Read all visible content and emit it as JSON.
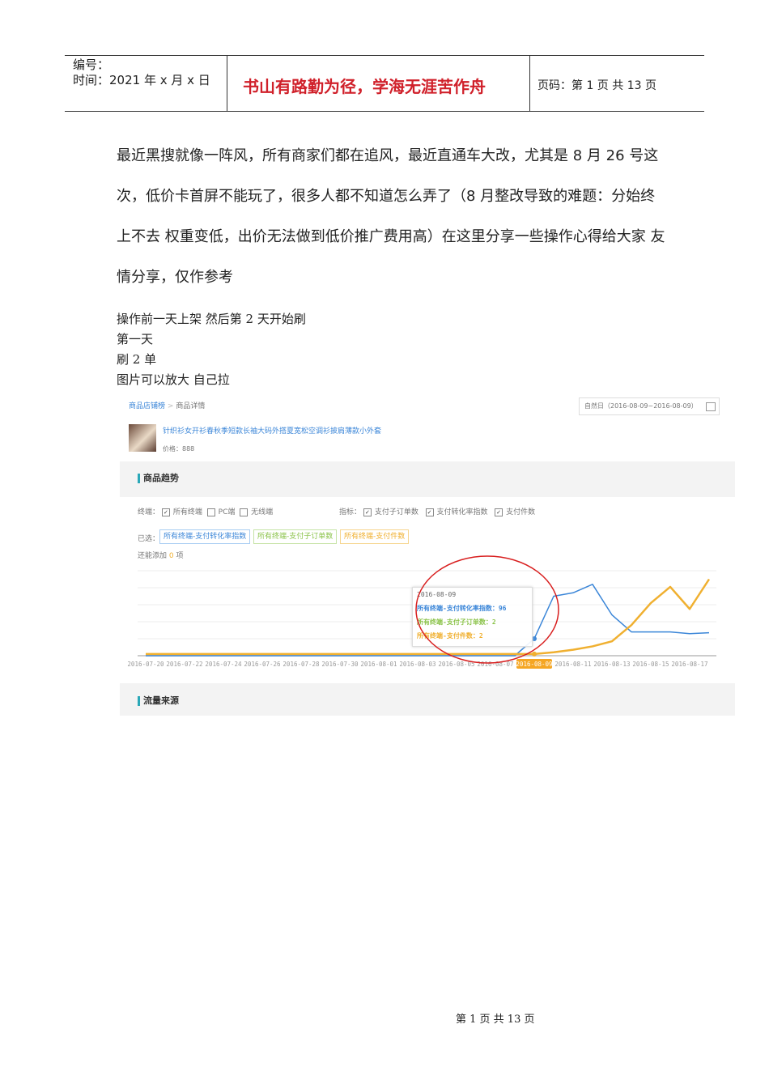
{
  "header": {
    "number_label": "编号：",
    "date_line": "时间：2021 年 x 月 x 日",
    "motto": "书山有路勤为径，学海无涯苦作舟",
    "page_info": "页码：第 1 页  共 13 页"
  },
  "body": {
    "paragraph": "最近黑搜就像一阵风，所有商家们都在追风，最近直通车大改，尤其是 8 月 26 号这次，低价卡首屏不能玩了，很多人都不知道怎么弄了（8 月整改导致的难题：分始终上不去 权重变低，出价无法做到低价推广费用高）在这里分享一些操作心得给大家  友情分享，仅作参考",
    "lines": [
      "操作前一天上架  然后第 2 天开始刷",
      "第一天",
      "刷 2 单",
      "图片可以放大  自己拉"
    ]
  },
  "shot": {
    "breadcrumb": [
      "商品店铺榜",
      "商品详情"
    ],
    "date_range": "自然日（2016-08-09~2016-08-09）",
    "product_title": "针织衫女开衫春秋季短款长袖大码外搭夏宽松空调衫披肩薄款小外套",
    "price": "价格：888",
    "trend_title": "商品趋势",
    "terminal_label": "终端：",
    "terminals": [
      "所有终端",
      "PC端",
      "无线端"
    ],
    "terminal_checked": [
      true,
      false,
      false
    ],
    "metric_label": "指标：",
    "metrics": [
      "支付子订单数",
      "支付转化率指数",
      "支付件数"
    ],
    "selected_label": "已选：",
    "selected": [
      "所有终端-支付转化率指数",
      "所有终端-支付子订单数",
      "所有终端-支付件数"
    ],
    "remain_prefix": "还能添加",
    "remain_count": "0",
    "remain_suffix": "项",
    "traffic_title": "流量来源"
  },
  "tooltip": {
    "date": "2016-08-09",
    "rows": [
      "所有终端-支付转化率指数：96",
      "所有终端-支付子订单数：2",
      "所有终端-支付件数：2"
    ]
  },
  "colors": {
    "blue": "#3b86d8",
    "yellow": "#f0b030",
    "green": "#8bc34a",
    "annotation": "#d81e1e"
  },
  "chart_data": {
    "type": "line",
    "x": [
      "2016-07-20",
      "2016-07-21",
      "2016-07-22",
      "2016-07-23",
      "2016-07-24",
      "2016-07-25",
      "2016-07-26",
      "2016-07-27",
      "2016-07-28",
      "2016-07-29",
      "2016-07-30",
      "2016-07-31",
      "2016-08-01",
      "2016-08-02",
      "2016-08-03",
      "2016-08-04",
      "2016-08-05",
      "2016-08-06",
      "2016-08-07",
      "2016-08-08",
      "2016-08-09",
      "2016-08-10",
      "2016-08-11",
      "2016-08-12",
      "2016-08-13",
      "2016-08-14",
      "2016-08-15",
      "2016-08-16",
      "2016-08-17",
      "2016-08-18"
    ],
    "tick_labels": [
      "2016-07-20",
      "2016-07-22",
      "2016-07-24",
      "2016-07-26",
      "2016-07-28",
      "2016-07-30",
      "2016-08-01",
      "2016-08-03",
      "2016-08-05",
      "2016-08-07",
      "2016-08-09",
      "2016-08-11",
      "2016-08-13",
      "2016-08-15",
      "2016-08-17"
    ],
    "highlight": "2016-08-09",
    "ylim": [
      0,
      100
    ],
    "series": [
      {
        "name": "所有终端-支付转化率指数",
        "values": [
          0,
          0,
          0,
          0,
          0,
          0,
          0,
          0,
          0,
          0,
          0,
          0,
          0,
          0,
          0,
          0,
          0,
          0,
          0,
          0,
          20,
          70,
          74,
          84,
          48,
          28,
          28,
          28,
          26,
          27
        ]
      },
      {
        "name": "所有终端-支付子订单数",
        "values": [
          2,
          2,
          2,
          2,
          2,
          2,
          2,
          2,
          2,
          2,
          2,
          2,
          2,
          2,
          2,
          2,
          2,
          2,
          2,
          2,
          2,
          4,
          7,
          11,
          17,
          36,
          62,
          81,
          55,
          90
        ]
      }
    ]
  }
}
